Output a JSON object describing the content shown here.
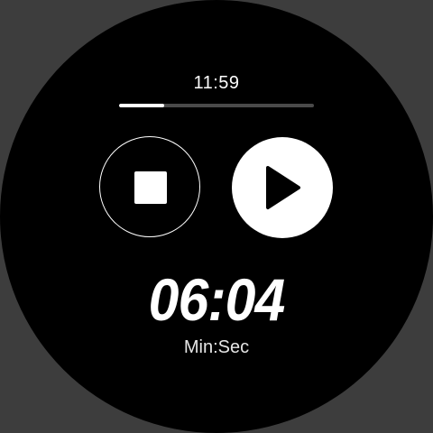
{
  "status": {
    "time": "11:59"
  },
  "progress": {
    "fraction": 0.23
  },
  "controls": {
    "stop_icon": "stop-icon",
    "play_icon": "play-icon"
  },
  "timer": {
    "value": "06:04",
    "unit_label": "Min:Sec"
  },
  "colors": {
    "background": "#000000",
    "foreground": "#ffffff",
    "track": "#4a4a4a"
  }
}
